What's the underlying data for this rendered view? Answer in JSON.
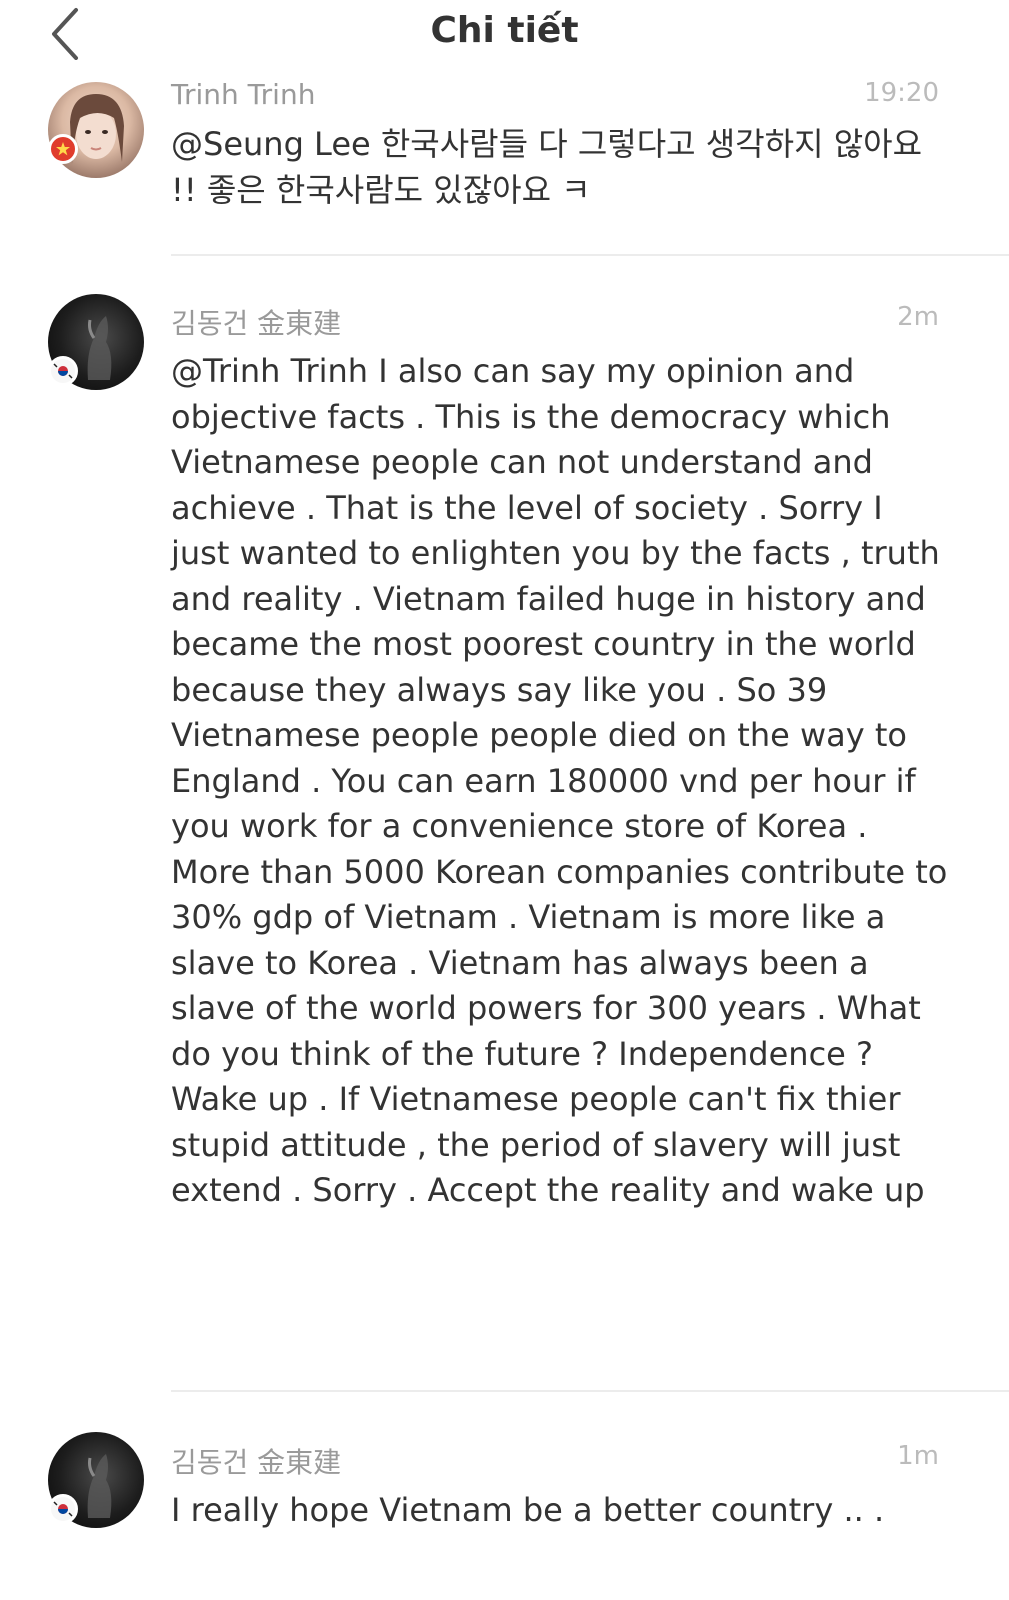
{
  "header": {
    "title": "Chi tiết"
  },
  "comments": [
    {
      "name": "Trinh Trinh",
      "time": "19:20",
      "mention": "@Seung Lee",
      "text": " 한국사람들 다 그렇다고 생각하지 않아요 !! 좋은 한국사람도 있잖아요 ㅋ",
      "badge": "vietnam-flag-icon"
    },
    {
      "name": "김동건 金東建",
      "time": "2m",
      "mention": "@Trinh Trinh",
      "text": " I also can say my opinion and objective facts . This is the democracy which Vietnamese people can not understand and achieve . That is the level of society . Sorry I just wanted to enlighten you by the facts , truth and reality . Vietnam failed huge in history and became the most poorest country in the world because they always say like you . So 39 Vietnamese people people died on the way to England . You can earn 180000 vnd per hour if you work for a convenience store of Korea . More than 5000 Korean companies contribute to 30% gdp of Vietnam . Vietnam is more like a slave to Korea . Vietnam has always been a slave of the world powers for 300 years . What do you think of the future ? Independence ? Wake up . If Vietnamese people can't fix thier stupid attitude , the period of slavery will just extend . Sorry . Accept the reality and wake up",
      "badge": "korea-flag-icon"
    },
    {
      "name": "김동건 金東建",
      "time": "1m",
      "mention": "",
      "text": "I really hope Vietnam be a better country .. .",
      "badge": "korea-flag-icon"
    }
  ]
}
